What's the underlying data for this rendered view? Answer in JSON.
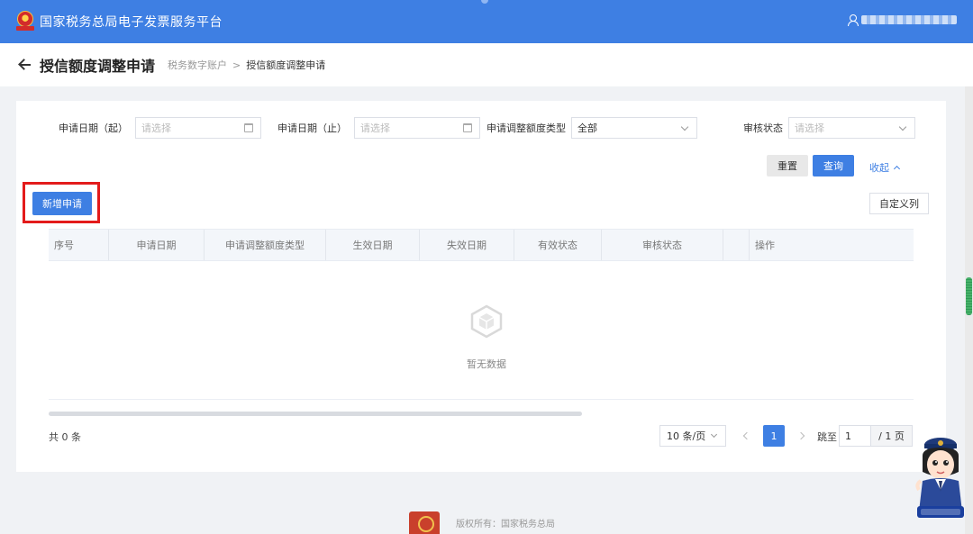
{
  "header": {
    "app_title": "国家税务总局电子发票服务平台"
  },
  "subheader": {
    "page_title": "授信额度调整申请",
    "breadcrumb": [
      "税务数字账户",
      "授信额度调整申请"
    ],
    "breadcrumb_separator": ">"
  },
  "filters": {
    "start_date_label": "申请日期（起）",
    "start_date_placeholder": "请选择",
    "end_date_label": "申请日期（止）",
    "end_date_placeholder": "请选择",
    "type_label": "申请调整额度类型",
    "type_value": "全部",
    "status_label": "审核状态",
    "status_placeholder": "请选择"
  },
  "actions": {
    "reset": "重置",
    "query": "查询",
    "collapse": "收起",
    "new_application": "新增申请",
    "customize_columns": "自定义列"
  },
  "table": {
    "columns": [
      "序号",
      "申请日期",
      "申请调整额度类型",
      "生效日期",
      "失效日期",
      "有效状态",
      "审核状态",
      "操作"
    ],
    "empty_text": "暂无数据"
  },
  "pagination": {
    "total_text": "共 0 条",
    "page_size": "10 条/页",
    "current_page": "1",
    "goto_label": "跳至",
    "goto_value": "1",
    "total_pages": "/ 1 页"
  },
  "footer": {
    "copyright": "版权所有：国家税务总局"
  },
  "colors": {
    "primary": "#3e7fe3",
    "highlight": "#e31b1b"
  }
}
